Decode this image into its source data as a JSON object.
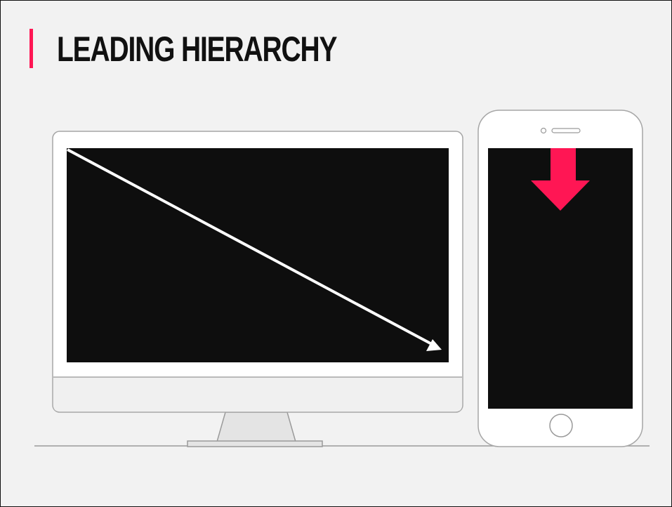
{
  "slide": {
    "title": "LEADING HIERARCHY"
  },
  "colors": {
    "background": "#f2f2f2",
    "accent": "#ff1654",
    "screen": "#0e0e0e",
    "device_outline": "#a6a6a6",
    "desktop_arrow": "#ffffff"
  },
  "illustration": {
    "desktop_arrow_icon": "diagonal-arrow-icon",
    "phone_arrow_icon": "down-arrow-icon"
  }
}
